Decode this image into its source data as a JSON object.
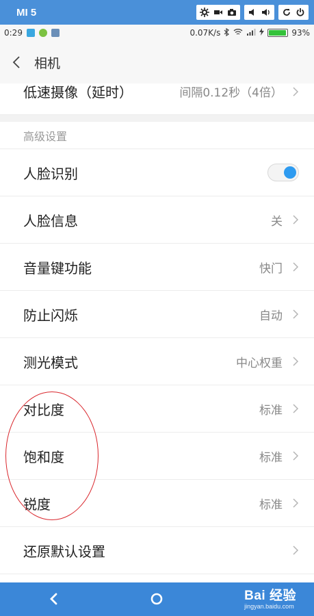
{
  "emulator": {
    "title": "MI 5"
  },
  "status_bar": {
    "time": "0:29",
    "net_speed": "0.07K/s",
    "battery_percent": "93%",
    "battery_level": 0.93
  },
  "header": {
    "title": "相机"
  },
  "partial_row": {
    "label": "低速摄像（延时）",
    "value": "间隔0.12秒（4倍）"
  },
  "section": {
    "title": "高级设置"
  },
  "settings": {
    "face_recognition": {
      "label": "人脸识别",
      "enabled": true
    },
    "face_info": {
      "label": "人脸信息",
      "value": "关"
    },
    "volume_key": {
      "label": "音量键功能",
      "value": "快门"
    },
    "anti_flicker": {
      "label": "防止闪烁",
      "value": "自动"
    },
    "metering": {
      "label": "测光模式",
      "value": "中心权重"
    },
    "contrast": {
      "label": "对比度",
      "value": "标准"
    },
    "saturation": {
      "label": "饱和度",
      "value": "标准"
    },
    "sharpness": {
      "label": "锐度",
      "value": "标准"
    },
    "reset": {
      "label": "还原默认设置"
    }
  },
  "watermark": {
    "brand": "Bai 经验",
    "url": "jingyan.baidu.com"
  },
  "colors": {
    "accent": "#2e9bf0",
    "emulator_bar": "#4a90d9",
    "nav_bar": "#3b87d8",
    "annotation": "#d9262c"
  }
}
